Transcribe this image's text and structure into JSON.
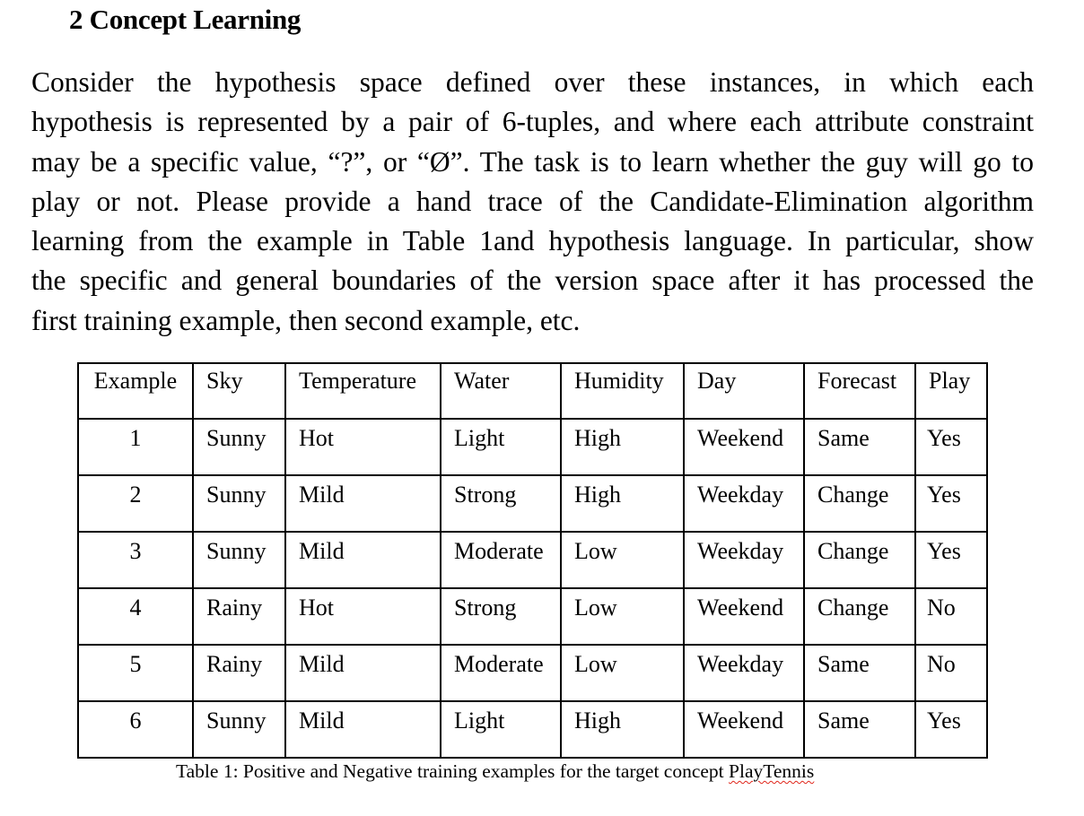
{
  "section": {
    "heading": "2 Concept Learning"
  },
  "paragraph": {
    "lines": [
      "Consider the hypothesis space defined over these instances, in which each",
      "hypothesis is represented by a pair of 6-tuples, and where each attribute constraint",
      "may be a specific value, “?”, or “Ø”.  The task is to learn whether the guy will go to",
      "play or not. Please provide a hand trace of the Candidate-Elimination algorithm",
      "learning from the example in Table 1and hypothesis language. In particular, show",
      "the specific and general boundaries of the version space after it has processed the",
      "first training example, then second example, etc."
    ]
  },
  "table": {
    "headers": [
      "Example",
      "Sky",
      "Temperature",
      "Water",
      "Humidity",
      "Day",
      "Forecast",
      "Play"
    ],
    "rows": [
      [
        "1",
        "Sunny",
        "Hot",
        "Light",
        "High",
        "Weekend",
        "Same",
        "Yes"
      ],
      [
        "2",
        "Sunny",
        "Mild",
        "Strong",
        "High",
        "Weekday",
        "Change",
        "Yes"
      ],
      [
        "3",
        "Sunny",
        "Mild",
        "Moderate",
        "Low",
        "Weekday",
        "Change",
        "Yes"
      ],
      [
        "4",
        "Rainy",
        "Hot",
        "Strong",
        "Low",
        "Weekend",
        "Change",
        "No"
      ],
      [
        "5",
        "Rainy",
        "Mild",
        "Moderate",
        "Low",
        "Weekday",
        "Same",
        "No"
      ],
      [
        "6",
        "Sunny",
        "Mild",
        "Light",
        "High",
        "Weekend",
        "Same",
        "Yes"
      ]
    ]
  },
  "caption": {
    "prefix": "Table 1: Positive and Negative training examples for the target concept ",
    "flagged_word": "PlayTennis"
  },
  "colors": {
    "text": "#000000",
    "spellcheck_underline": "#e0261b"
  }
}
